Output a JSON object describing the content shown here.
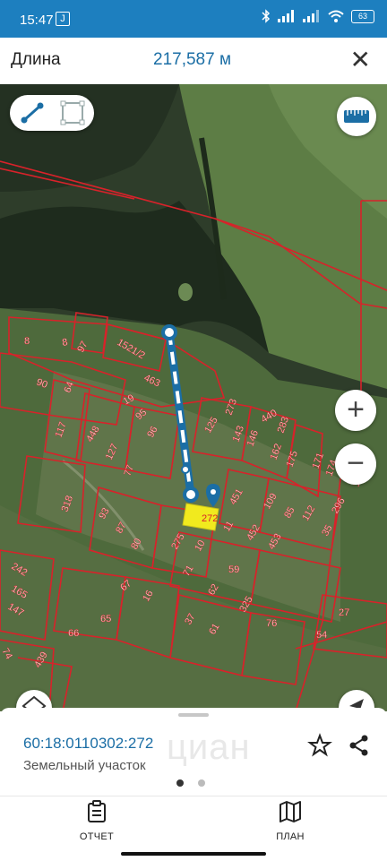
{
  "status_bar": {
    "time": "15:47",
    "notification_badge": "J",
    "battery": "63"
  },
  "header": {
    "label": "Длина",
    "value": "217,587 м"
  },
  "map": {
    "parcel_labels": [
      "8",
      "8",
      "97",
      "1521/2",
      "90",
      "64",
      "463",
      "19",
      "95",
      "117",
      "448",
      "127",
      "96",
      "77",
      "125",
      "273",
      "440",
      "143",
      "146",
      "283",
      "162",
      "175",
      "171",
      "174",
      "114",
      "318",
      "93",
      "87",
      "80",
      "275",
      "451",
      "10",
      "11",
      "109",
      "85",
      "112",
      "452",
      "453",
      "35",
      "296",
      "242",
      "165",
      "147",
      "67",
      "16",
      "71",
      "62",
      "59",
      "325",
      "65",
      "66",
      "37",
      "61",
      "76",
      "27",
      "54",
      "74",
      "439"
    ],
    "highlighted_parcel_label": "272",
    "colors": {
      "boundary": "#d8222a",
      "measure_line": "#1b6ea5",
      "highlight": "#f1ea1e"
    }
  },
  "controls": {
    "line_tool_icon": "line-measure-icon",
    "area_tool_icon": "area-measure-icon",
    "ruler_icon": "ruler-icon",
    "zoom_in_label": "+",
    "zoom_out_label": "−"
  },
  "sheet": {
    "cadastral_number": "60:18:0110302:272",
    "parcel_type": "Земельный участок",
    "watermark": "циан",
    "page_index": 1,
    "page_count": 2
  },
  "tabs": [
    {
      "label": "ОТЧЕТ",
      "icon": "report-icon"
    },
    {
      "label": "ПЛАН",
      "icon": "map-plan-icon"
    }
  ]
}
